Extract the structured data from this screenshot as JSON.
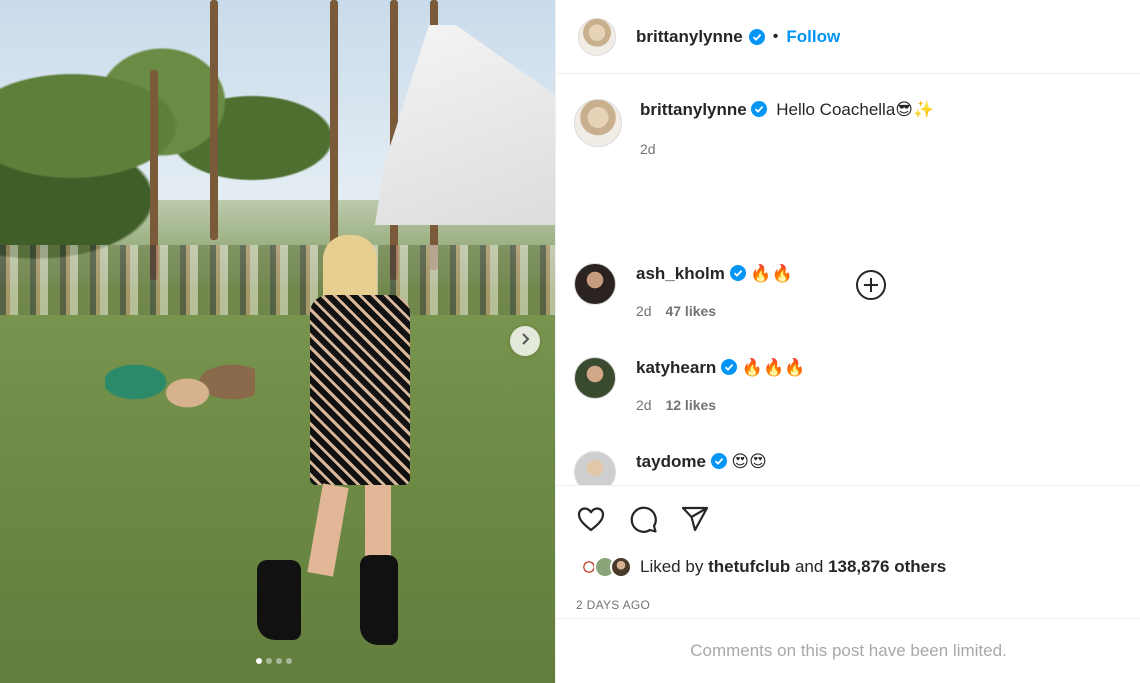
{
  "post": {
    "author": "brittanylynne",
    "follow_label": "Follow",
    "bullet": "•",
    "caption": "Hello Coachella😎✨",
    "caption_time": "2d",
    "carousel_dots": 4,
    "carousel_active": 1
  },
  "comments": [
    {
      "user": "ash_kholm",
      "text": "🔥🔥",
      "time": "2d",
      "likes": "47 likes"
    },
    {
      "user": "katyhearn",
      "text": "🔥🔥🔥",
      "time": "2d",
      "likes": "12 likes"
    },
    {
      "user": "taydome",
      "text": "😍😍"
    }
  ],
  "likes": {
    "prefix": "Liked by",
    "user": "thetufclub",
    "middle": "and",
    "count": "138,876 others"
  },
  "date_label": "2 DAYS AGO",
  "limited_text": "Comments on this post have been limited.",
  "colors": {
    "accent": "#0095f6",
    "verified": "#0095f6",
    "muted": "#737373",
    "text": "#262626"
  },
  "icons": {
    "verified": "verified-badge-icon",
    "more_replies": "plus-circle-icon",
    "like": "heart-icon",
    "comment": "comment-icon",
    "share": "paper-plane-icon",
    "next": "chevron-right-icon"
  }
}
